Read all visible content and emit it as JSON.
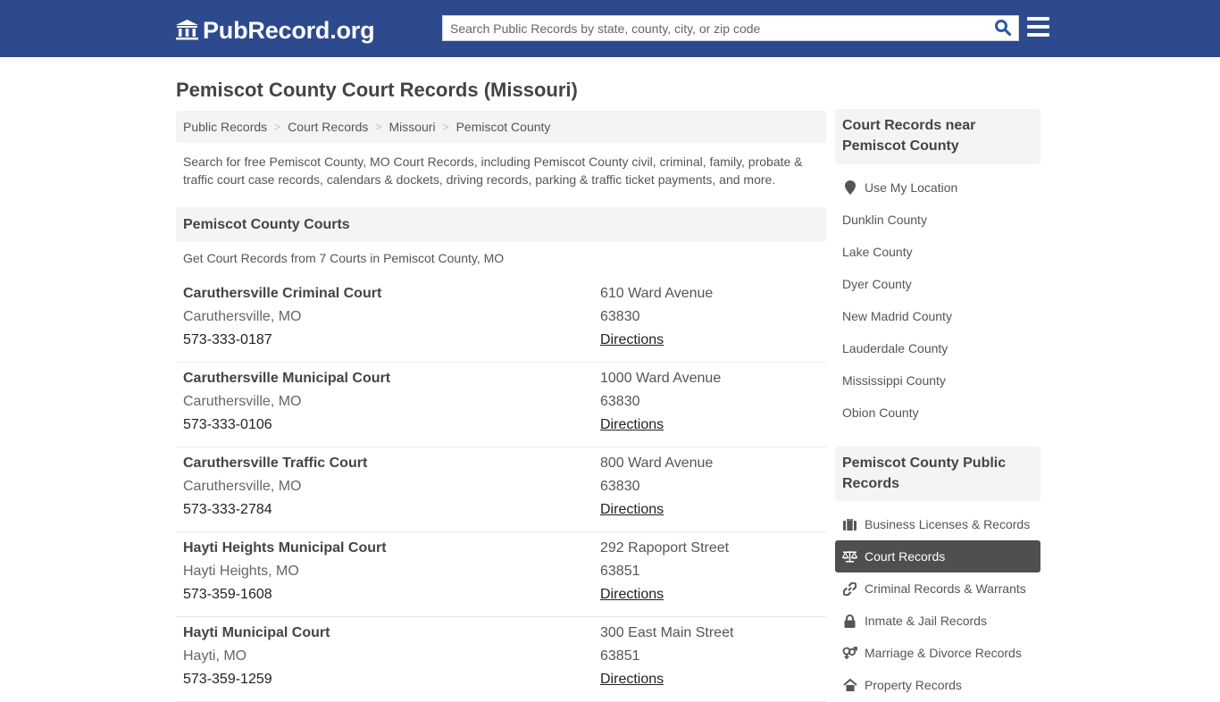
{
  "header": {
    "logo_text": "PubRecord.org",
    "logo_icon": "courthouse-icon",
    "search_placeholder": "Search Public Records by state, county, city, or zip code",
    "search_value": "",
    "search_icon": "search-icon",
    "menu_icon": "hamburger-menu-icon"
  },
  "colors": {
    "brand": "#2e4a8e",
    "panel_bg": "#f4f4f4",
    "active_item": "#4f4f4f"
  },
  "page": {
    "title": "Pemiscot County Court Records (Missouri)",
    "breadcrumb": [
      "Public Records",
      "Court Records",
      "Missouri",
      "Pemiscot County"
    ],
    "breadcrumb_separator": ">",
    "intro": "Search for free Pemiscot County, MO Court Records, including Pemiscot County civil, criminal, family, probate & traffic court case records, calendars & dockets, driving records, parking & traffic ticket payments, and more."
  },
  "courts_section": {
    "heading": "Pemiscot County Courts",
    "count_text": "Get Court Records from 7 Courts in Pemiscot County, MO",
    "directions_label": "Directions",
    "courts": [
      {
        "name": "Caruthersville Criminal Court",
        "city": "Caruthersville, MO",
        "phone": "573-333-0187",
        "address": "610 Ward Avenue",
        "zip": "63830"
      },
      {
        "name": "Caruthersville Municipal Court",
        "city": "Caruthersville, MO",
        "phone": "573-333-0106",
        "address": "1000 Ward Avenue",
        "zip": "63830"
      },
      {
        "name": "Caruthersville Traffic Court",
        "city": "Caruthersville, MO",
        "phone": "573-333-2784",
        "address": "800 Ward Avenue",
        "zip": "63830"
      },
      {
        "name": "Hayti Heights Municipal Court",
        "city": "Hayti Heights, MO",
        "phone": "573-359-1608",
        "address": "292 Rapoport Street",
        "zip": "63851"
      },
      {
        "name": "Hayti Municipal Court",
        "city": "Hayti, MO",
        "phone": "573-359-1259",
        "address": "300 East Main Street",
        "zip": "63851"
      }
    ]
  },
  "sidebar": {
    "near": {
      "heading": "Court Records near Pemiscot County",
      "use_location": "Use My Location",
      "counties": [
        "Dunklin County",
        "Lake County",
        "Dyer County",
        "New Madrid County",
        "Lauderdale County",
        "Mississippi County",
        "Obion County"
      ]
    },
    "public_records": {
      "heading": "Pemiscot County Public Records",
      "items": [
        {
          "label": "Business Licenses & Records",
          "icon": "briefcase-icon",
          "active": false
        },
        {
          "label": "Court Records",
          "icon": "balance-scale-icon",
          "active": true
        },
        {
          "label": "Criminal Records & Warrants",
          "icon": "handcuffs-link-icon",
          "active": false
        },
        {
          "label": "Inmate & Jail Records",
          "icon": "lock-icon",
          "active": false
        },
        {
          "label": "Marriage & Divorce Records",
          "icon": "gender-rings-icon",
          "active": false
        },
        {
          "label": "Property Records",
          "icon": "home-icon",
          "active": false
        }
      ]
    }
  }
}
